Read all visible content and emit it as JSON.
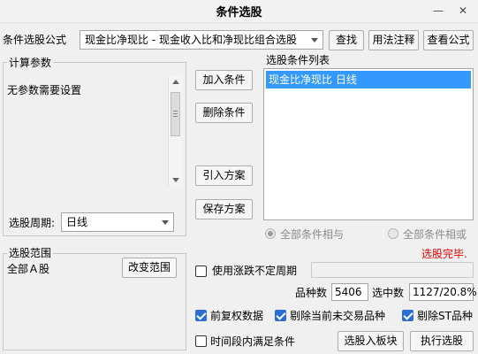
{
  "window": {
    "title": "条件选股",
    "minimize_glyph": "—",
    "close_glyph": "✕"
  },
  "formula": {
    "label": "条件选股公式",
    "selected": "现金比净现比  -  现金收入比和净现比组合选股",
    "find_button": "查找",
    "usage_button": "用法注释",
    "view_button": "查看公式"
  },
  "params": {
    "group_label": "计算参数",
    "text": "无参数需要设置",
    "period_label": "选股周期:",
    "period_value": "日线"
  },
  "conditions": {
    "add_button": "加入条件",
    "delete_button": "删除条件",
    "import_button": "引入方案",
    "save_button": "保存方案",
    "list_label": "选股条件列表",
    "items": [
      "现金比净现比  日线"
    ],
    "and_label": "全部条件相与",
    "or_label": "全部条件相或",
    "status": "选股完毕."
  },
  "scope": {
    "group_label": "选股范围",
    "value": "全部Ａ股",
    "change_button": "改变范围"
  },
  "options": {
    "irregular_period_label": "使用涨跌不定周期",
    "count_label": "品种数",
    "count_value": "5406",
    "selected_label": "选中数",
    "selected_value": "1127/20.8%",
    "adjusted_label": "前复权数据",
    "exclude_untraded_label": "剔除当前未交易品种",
    "exclude_st_label": "剔除ST品种",
    "time_range_label": "时间段内满足条件",
    "to_board_button": "选股入板块",
    "run_button": "执行选股"
  },
  "colors": {
    "selection_bg": "#3399ff",
    "status_red": "#e00000",
    "check_blue": "#2b6fd6"
  }
}
